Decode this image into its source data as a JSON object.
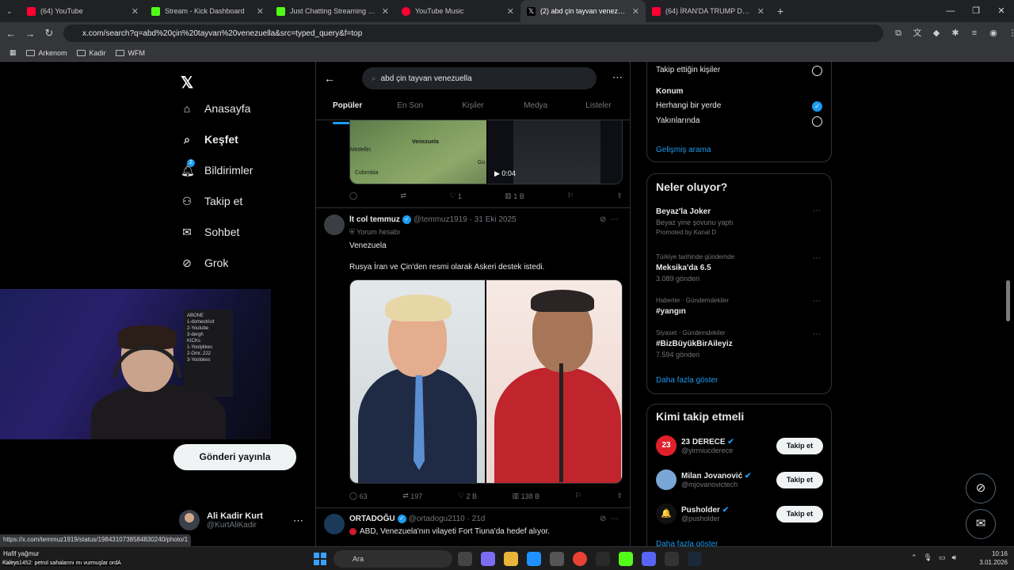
{
  "browser": {
    "tabs": [
      {
        "label": "(64) YouTube",
        "color": "#ff0033"
      },
      {
        "label": "Stream - Kick Dashboard",
        "color": "#53fc18"
      },
      {
        "label": "Just Chatting Streaming - Live",
        "color": "#53fc18"
      },
      {
        "label": "YouTube Music",
        "color": "#ff0033"
      },
      {
        "label": "(2) abd çin tayvan venezuel",
        "color": "#ffffff"
      },
      {
        "label": "(64) İRAN'DA TRUMP DEPREMİ",
        "color": "#ff0033"
      }
    ],
    "url": "x.com/search?q=abd%20çin%20tayvan%20venezuella&src=typed_query&f=top",
    "bookmarks": [
      "Arkenom",
      "Kadir",
      "WFM"
    ]
  },
  "sidebar": {
    "items": [
      {
        "label": "Anasayfa",
        "icon": "home-icon"
      },
      {
        "label": "Keşfet",
        "icon": "search-icon"
      },
      {
        "label": "Bildirimler",
        "icon": "bell-icon",
        "badge": "2"
      },
      {
        "label": "Takip et",
        "icon": "add-user-icon"
      },
      {
        "label": "Sohbet",
        "icon": "mail-icon"
      },
      {
        "label": "Grok",
        "icon": "grok-icon"
      }
    ],
    "post_button": "Gönderi yayınla",
    "profile": {
      "name": "Ali Kadir Kurt",
      "handle": "@KurtAliKadir"
    }
  },
  "webcam": {
    "board_lines": [
      "ABONE",
      "1-domestricit",
      "2-Youtube",
      "3-dergh",
      "KICKs",
      "1-Yoolykkes",
      "2-Omr..222",
      "3-Yoolokes"
    ]
  },
  "search": {
    "query": "abd çin tayvan venezuella",
    "tabs": [
      "Popüler",
      "En Son",
      "Kişiler",
      "Medya",
      "Listeler"
    ]
  },
  "post1": {
    "map_labels": [
      "Venezuela",
      "Medellin",
      "Colombia",
      "Gu"
    ],
    "video_time": "0:04",
    "stats": {
      "reply": "",
      "repost": "",
      "like": "1",
      "views": "1 B"
    }
  },
  "post2": {
    "name": "lt col temmuz",
    "handle": "@temmuz1919",
    "date": "· 31 Eki 2025",
    "context": "Yorum hesabı",
    "line1": "Venezuela",
    "line2": "Rusya İran ve Çin'den resmi olarak Askeri destek istedi.",
    "stats": {
      "reply": "63",
      "repost": "197",
      "like": "2 B",
      "views": "138 B"
    }
  },
  "post3": {
    "name": "ORTADOĞU",
    "handle": "@ortadogu2110",
    "date": "· 21d",
    "text": "ABD, Venezuela'nın vilayeti Fort Tiuna'da hedef alıyor."
  },
  "filters": {
    "people_option": "Takip ettiğin kişiler",
    "location_heading": "Konum",
    "loc_anywhere": "Herhangi bir yerde",
    "loc_nearby": "Yakınlarında",
    "advanced": "Gelişmiş arama"
  },
  "trends": {
    "heading": "Neler oluyor?",
    "items": [
      {
        "meta": "",
        "title": "Beyaz'la Joker",
        "sub": "Beyaz yine şovunu yaptı",
        "extra": "Promoted by Kanal D"
      },
      {
        "meta": "Türkiye tarihinde gündemde",
        "title": "Meksika'da 6.5",
        "sub": "3.089 gönderi"
      },
      {
        "meta": "Haberler · Gündemdekiler",
        "title": "#yangın",
        "sub": ""
      },
      {
        "meta": "Siyaset · Gündemdekiler",
        "title": "#BizBüyükBirAileyiz",
        "sub": "7.594 gönderi"
      }
    ],
    "show_more": "Daha fazla göster"
  },
  "who_to_follow": {
    "heading": "Kimi takip etmeli",
    "items": [
      {
        "name": "23 DERECE",
        "handle": "@yirmiucderece",
        "avatar_text": "23",
        "color": "#e0202a"
      },
      {
        "name": "Milan Jovanović",
        "handle": "@mjovanovictech",
        "avatar_text": "",
        "color": "#7aa6d6"
      },
      {
        "name": "Pusholder",
        "handle": "@pusholder",
        "avatar_text": "🔔",
        "color": "#111111"
      }
    ],
    "follow_label": "Takip et",
    "show_more": "Daha fazla göster"
  },
  "status_url": "https://x.com/temmuz1919/status/1984310738584830240/photo/1",
  "taskbar": {
    "weather": "Hafif yağmur",
    "weather_sub": "Yakın",
    "search": "Ara",
    "time": "10:16",
    "date": "3.01.2026"
  },
  "stream_overlay": "Kaleys1452: petrol sahalarını mı vurmuşlar ordA",
  "colors": {
    "accent": "#1d9bf0",
    "bg": "#000000",
    "border": "#2f3336"
  }
}
